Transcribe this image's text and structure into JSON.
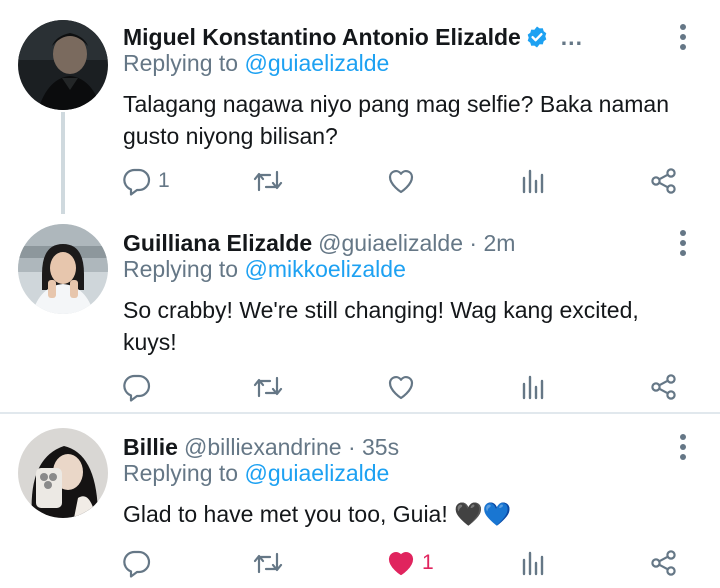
{
  "tweets": [
    {
      "name": "Miguel Konstantino Antonio Elizalde",
      "verified": true,
      "overflow_text": "...",
      "replying_prefix": "Replying to",
      "replying_to": "@guiaelizalde",
      "text": "Talagang nagawa niyo pang mag selfie? Baka naman gusto niyong bilisan?",
      "reply_count": "1",
      "like_count": "",
      "liked": false
    },
    {
      "name": "Guilliana Elizalde",
      "handle_time": "@guiaelizalde · 2m",
      "replying_prefix": "Replying to",
      "replying_to": "@mikkoelizalde",
      "text": "So crabby! We're still changing! Wag kang excited, kuys!",
      "reply_count": "",
      "like_count": "",
      "liked": false
    },
    {
      "name": "Billie",
      "handle_time": "@billiexandrine · 35s",
      "replying_prefix": "Replying to",
      "replying_to": "@guiaelizalde",
      "text": "Glad to have met you too, Guia! 🖤💙",
      "reply_count": "",
      "like_count": "1",
      "liked": true
    }
  ],
  "icons": {
    "reply": "reply-icon",
    "retweet": "retweet-icon",
    "like": "heart-icon",
    "analytics": "analytics-icon",
    "share": "share-icon",
    "more": "more-vertical-icon",
    "verified": "verified-badge-icon"
  },
  "colors": {
    "link": "#1da1f2",
    "muted": "#657786",
    "like": "#e0245e",
    "verified": "#1da1f2"
  }
}
